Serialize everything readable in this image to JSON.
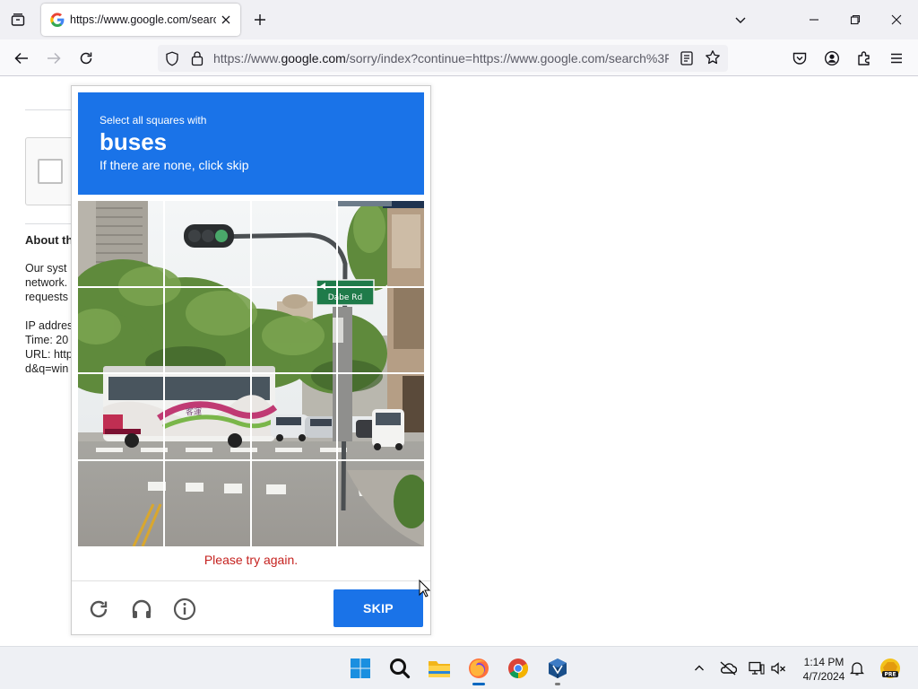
{
  "browser": {
    "tab": {
      "title": "https://www.google.com/search?q="
    },
    "url": {
      "prefix": "https://www.",
      "host": "google.com",
      "suffix": "/sorry/index?continue=https://www.google.com/search%3F"
    }
  },
  "page": {
    "about_title": "About th",
    "lines": [
      "Our syst",
      "network.",
      "requests",
      "IP addres",
      "Time: 20",
      "URL: http",
      "d&q=win"
    ]
  },
  "captcha": {
    "instruction_top": "Select all squares with",
    "object": "buses",
    "instruction_sub": "If there are none, click skip",
    "error": "Please try again.",
    "skip_label": "SKIP",
    "street_sign": "Dabe Rd",
    "header_color": "#1a73e8"
  },
  "taskbar": {
    "apps": [
      "windows-start",
      "search",
      "file-explorer",
      "firefox",
      "chrome",
      "virtualbox"
    ],
    "time": "1:14 PM",
    "date": "4/7/2024",
    "badge": "PRE"
  }
}
